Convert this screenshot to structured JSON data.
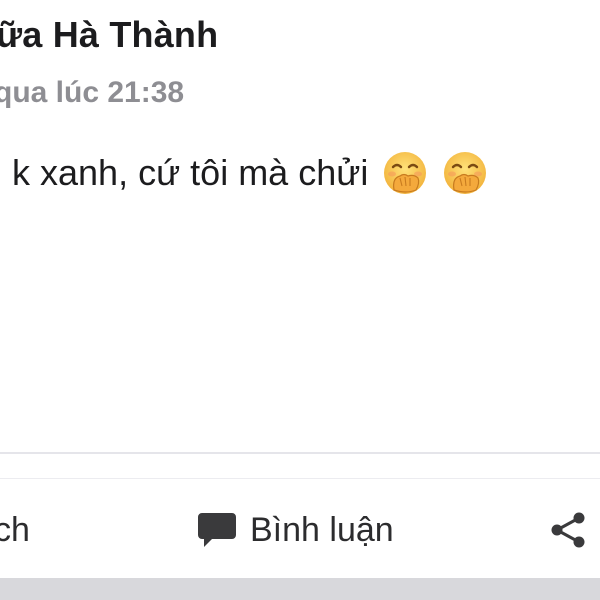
{
  "post": {
    "author": "ữa Hà Thành",
    "timestamp": "qua lúc 21:38",
    "text": "k xanh, cứ tôi mà chửi",
    "emoji": [
      "hand-over-mouth-emoji",
      "hand-over-mouth-emoji"
    ]
  },
  "actions": {
    "like_label": "ch",
    "comment_label": "Bình luận",
    "share_icon": "share-icon",
    "comment_icon": "comment-bubble-icon"
  },
  "colors": {
    "text": "#1c1c1e",
    "muted": "#8e8e93",
    "icon": "#3a3a3c",
    "emoji_face": "#f7c948",
    "emoji_hand": "#f3a93b"
  }
}
